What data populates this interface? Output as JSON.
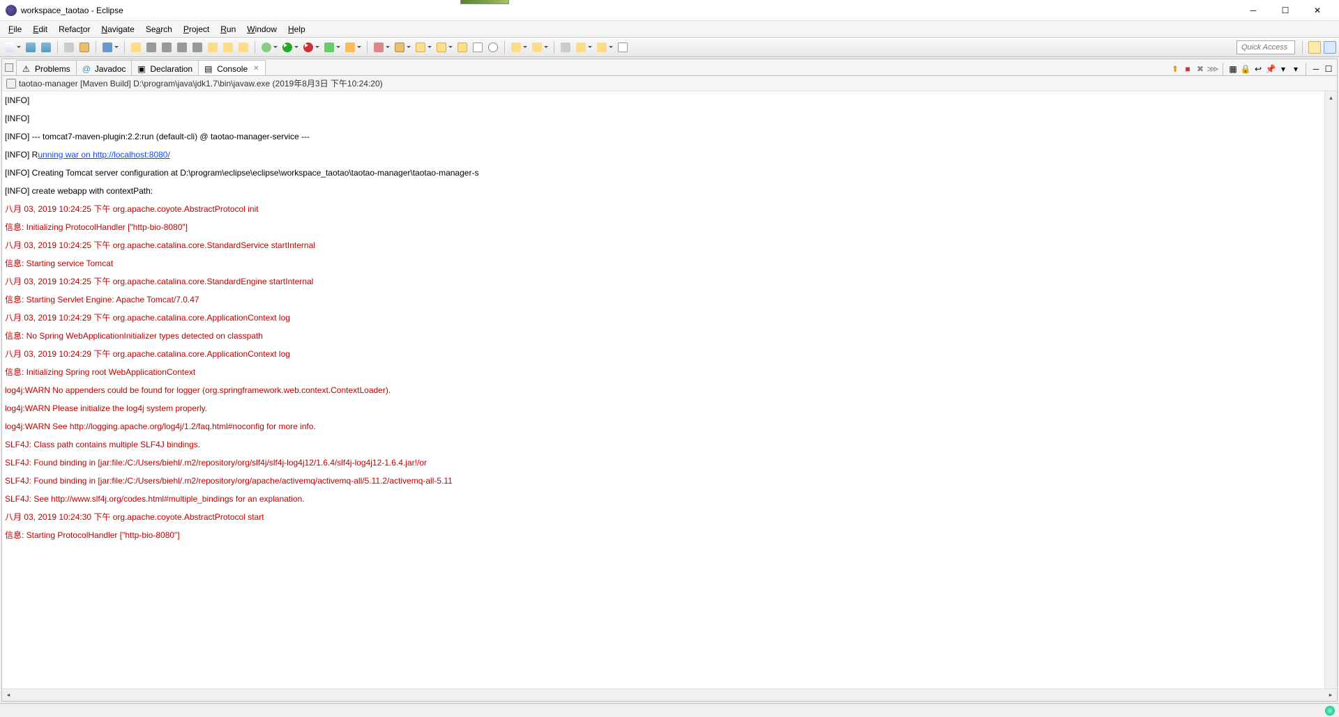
{
  "window": {
    "title": "workspace_taotao - Eclipse"
  },
  "menu": [
    "File",
    "Edit",
    "Refactor",
    "Navigate",
    "Search",
    "Project",
    "Run",
    "Window",
    "Help"
  ],
  "quick_access_placeholder": "Quick Access",
  "tabs": [
    {
      "label": "Problems",
      "icon": "problems"
    },
    {
      "label": "Javadoc",
      "icon": "javadoc"
    },
    {
      "label": "Declaration",
      "icon": "declaration"
    },
    {
      "label": "Console",
      "icon": "console",
      "active": true,
      "closable": true
    }
  ],
  "subheader": {
    "text": "taotao-manager [Maven Build] D:\\program\\java\\jdk1.7\\bin\\javaw.exe (2019年8月3日 下午10:24:20)"
  },
  "console": [
    {
      "kind": "black",
      "text": "[INFO]"
    },
    {
      "kind": "black",
      "text": "[INFO]"
    },
    {
      "kind": "black",
      "text": "[INFO] --- tomcat7-maven-plugin:2.2:run (default-cli) @ taotao-manager-service ---"
    },
    {
      "kind": "url",
      "prefix": "[INFO] R",
      "url": "unning war on http://localhost:8080/"
    },
    {
      "kind": "black",
      "text": "[INFO] Creating Tomcat server configuration at D:\\program\\eclipse\\eclipse\\workspace_taotao\\taotao-manager\\taotao-manager-s"
    },
    {
      "kind": "black",
      "text": "[INFO] create webapp with contextPath:"
    },
    {
      "kind": "red",
      "text": "八月 03, 2019 10:24:25 下午 org.apache.coyote.AbstractProtocol init"
    },
    {
      "kind": "red",
      "text": "信息: Initializing ProtocolHandler [\"http-bio-8080\"]"
    },
    {
      "kind": "red",
      "text": "八月 03, 2019 10:24:25 下午 org.apache.catalina.core.StandardService startInternal"
    },
    {
      "kind": "red",
      "text": "信息: Starting service Tomcat"
    },
    {
      "kind": "red",
      "text": "八月 03, 2019 10:24:25 下午 org.apache.catalina.core.StandardEngine startInternal"
    },
    {
      "kind": "red",
      "text": "信息: Starting Servlet Engine: Apache Tomcat/7.0.47"
    },
    {
      "kind": "red",
      "text": "八月 03, 2019 10:24:29 下午 org.apache.catalina.core.ApplicationContext log"
    },
    {
      "kind": "red",
      "text": "信息: No Spring WebApplicationInitializer types detected on classpath"
    },
    {
      "kind": "red",
      "text": "八月 03, 2019 10:24:29 下午 org.apache.catalina.core.ApplicationContext log"
    },
    {
      "kind": "red",
      "text": "信息: Initializing Spring root WebApplicationContext"
    },
    {
      "kind": "red",
      "text": "log4j:WARN No appenders could be found for logger (org.springframework.web.context.ContextLoader)."
    },
    {
      "kind": "red",
      "text": "log4j:WARN Please initialize the log4j system properly."
    },
    {
      "kind": "red",
      "text": "log4j:WARN See http://logging.apache.org/log4j/1.2/faq.html#noconfig for more info."
    },
    {
      "kind": "red",
      "text": "SLF4J: Class path contains multiple SLF4J bindings."
    },
    {
      "kind": "red",
      "text": "SLF4J: Found binding in [jar:file:/C:/Users/biehl/.m2/repository/org/slf4j/slf4j-log4j12/1.6.4/slf4j-log4j12-1.6.4.jar!/or"
    },
    {
      "kind": "red",
      "text": "SLF4J: Found binding in [jar:file:/C:/Users/biehl/.m2/repository/org/apache/activemq/activemq-all/5.11.2/activemq-all-5.11"
    },
    {
      "kind": "red",
      "text": "SLF4J: See http://www.slf4j.org/codes.html#multiple_bindings for an explanation."
    },
    {
      "kind": "red",
      "text": "八月 03, 2019 10:24:30 下午 org.apache.coyote.AbstractProtocol start"
    },
    {
      "kind": "red",
      "text": "信息: Starting ProtocolHandler [\"http-bio-8080\"]"
    }
  ]
}
